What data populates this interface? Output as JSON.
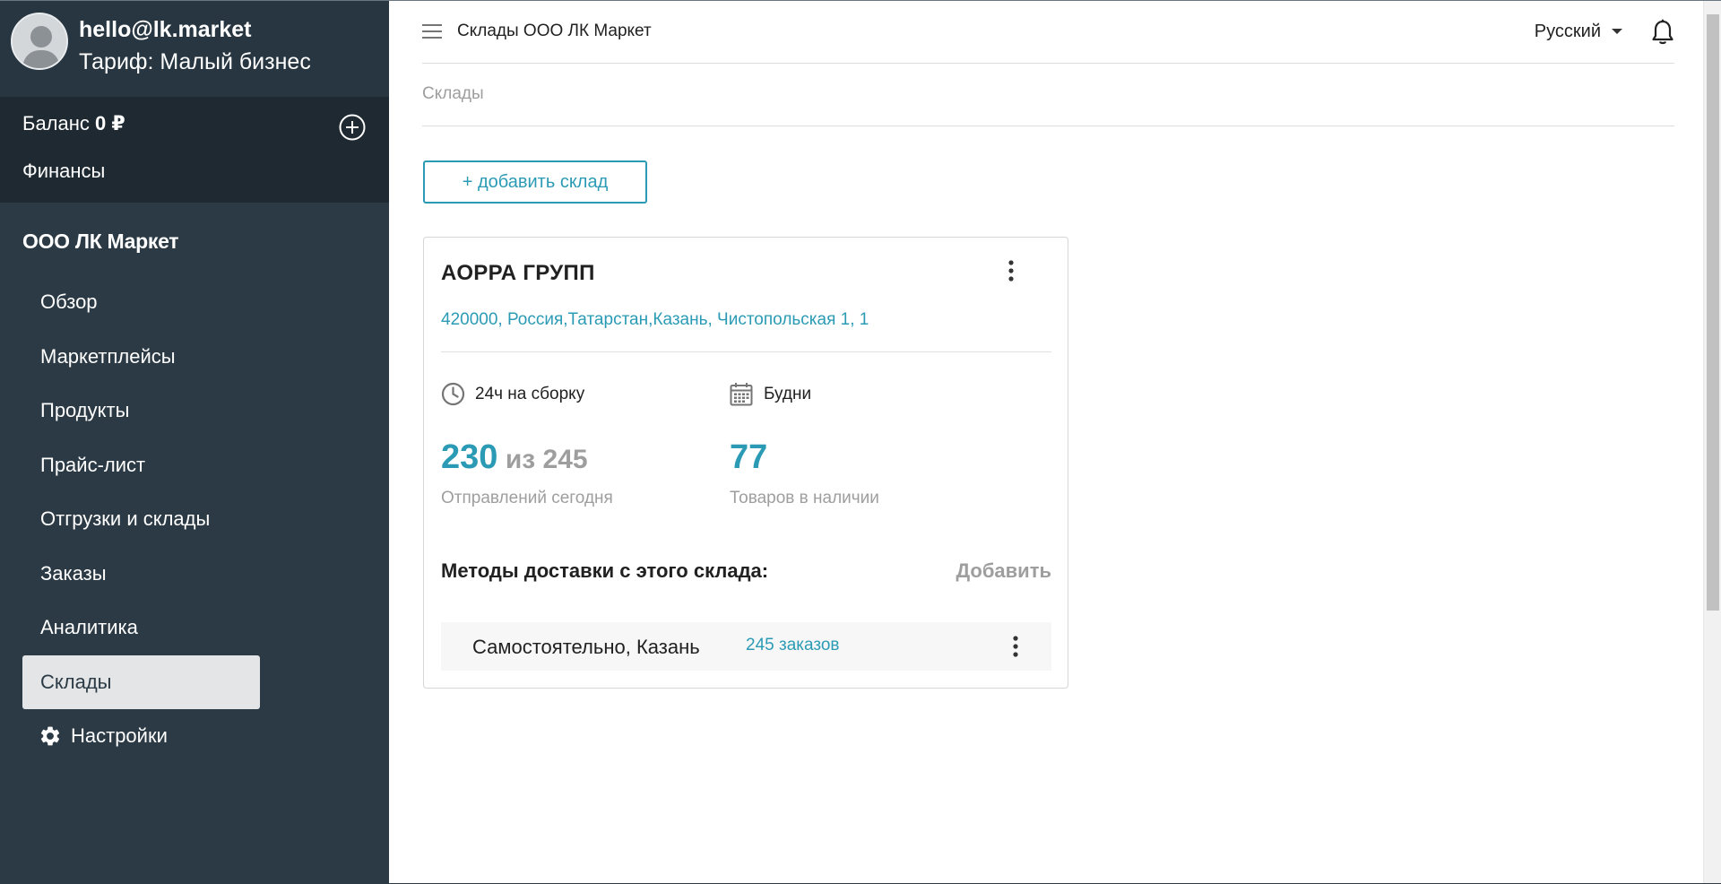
{
  "profile": {
    "email": "hello@lk.market",
    "plan": "Тариф: Малый бизнес",
    "avatar_icon": "user-avatar-icon"
  },
  "finance": {
    "balance_label": "Баланс",
    "balance_value": "0 ₽",
    "add_icon": "plus-circle-icon",
    "finance_link": "Финансы"
  },
  "sidebar": {
    "company": "ООО ЛК Маркет",
    "items": [
      {
        "label": "Обзор"
      },
      {
        "label": "Маркетплейсы"
      },
      {
        "label": "Продукты"
      },
      {
        "label": "Прайс-лист"
      },
      {
        "label": "Отгрузки и склады"
      },
      {
        "label": "Заказы"
      },
      {
        "label": "Аналитика"
      },
      {
        "label": "Склады",
        "active": true
      },
      {
        "label": "Настройки",
        "icon": "gear-icon"
      }
    ]
  },
  "topbar": {
    "title": "Склады ООО ЛК Маркет",
    "language": "Русский",
    "menu_icon": "hamburger-menu-icon",
    "bell_icon": "bell-icon"
  },
  "breadcrumb": "Склады",
  "add_button_label": "+ добавить склад",
  "warehouse": {
    "name": "АОРРА ГРУПП",
    "address": "420000, Россия,Татарстан,Казань, Чистопольская 1, 1",
    "assembly_time": "24ч на сборку",
    "work_days": "Будни",
    "shipments_today": "230",
    "shipments_of": "из 245",
    "shipments_label": "Отправлений сегодня",
    "goods_count": "77",
    "goods_label": "Товаров в наличии",
    "delivery_title": "Методы доставки с этого склада:",
    "delivery_add": "Добавить",
    "delivery_methods": [
      {
        "name": "Самостоятельно, Казань",
        "orders": "245 заказов"
      }
    ]
  },
  "colors": {
    "accent": "#2b9bb5",
    "sidebar_bg": "#2b3a44",
    "sidebar_dark": "#1e2931",
    "active_item_bg": "#e3e5e7",
    "muted_text": "#9e9e9e"
  }
}
